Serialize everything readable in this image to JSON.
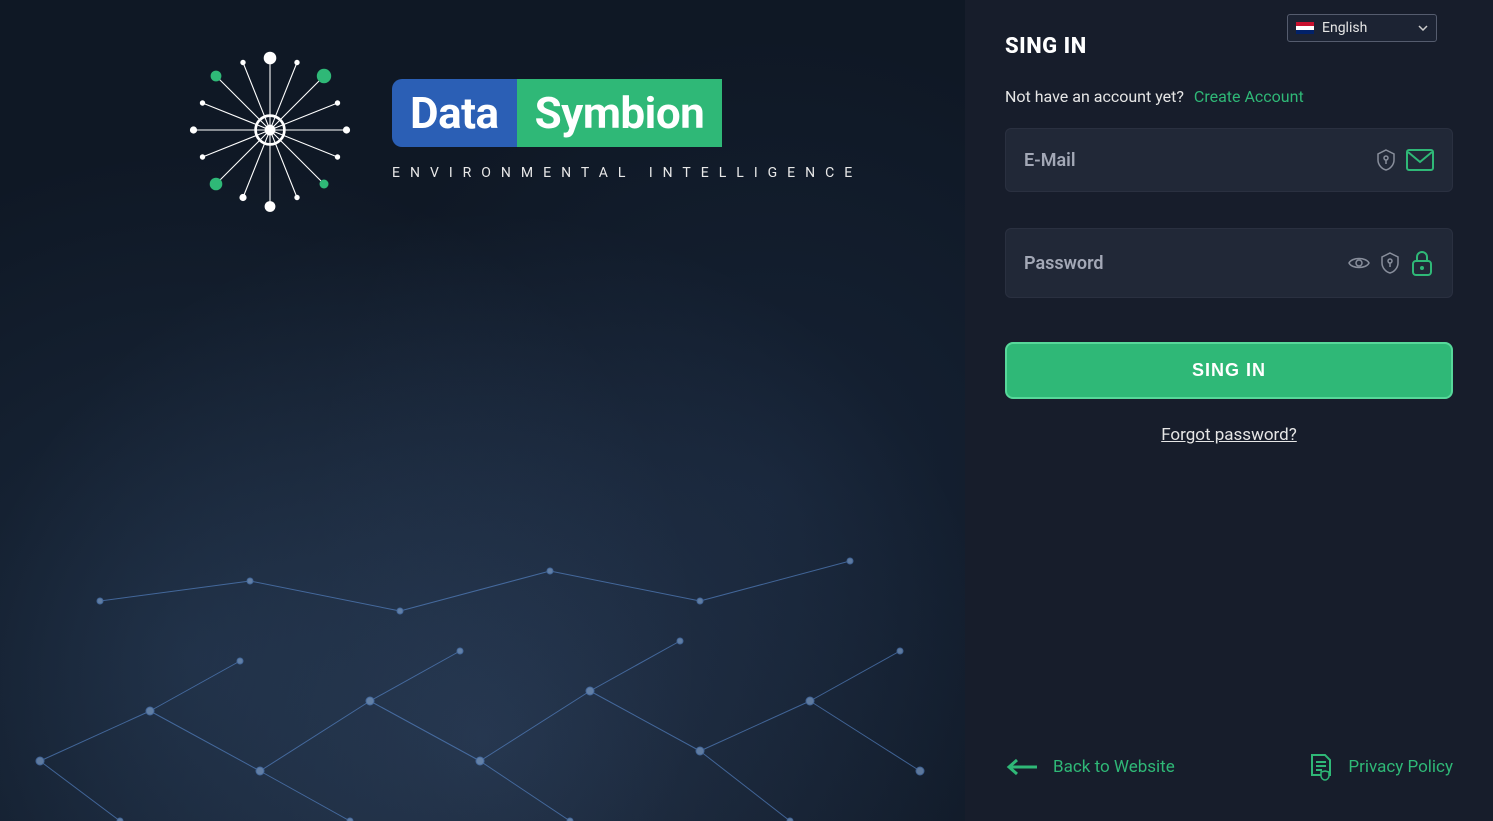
{
  "logo": {
    "word1": "Data",
    "word2": "Symbion",
    "subtitle": "ENVIRONMENTAL INTELLIGENCE"
  },
  "lang": {
    "current": "English"
  },
  "signin": {
    "heading": "SING IN",
    "no_account_text": "Not have an account yet?",
    "create_account": "Create Account",
    "email_label": "E-Mail",
    "password_label": "Password",
    "button": "SING IN",
    "forgot": "Forgot password?"
  },
  "footer": {
    "back": "Back to Website",
    "privacy": "Privacy Policy"
  }
}
